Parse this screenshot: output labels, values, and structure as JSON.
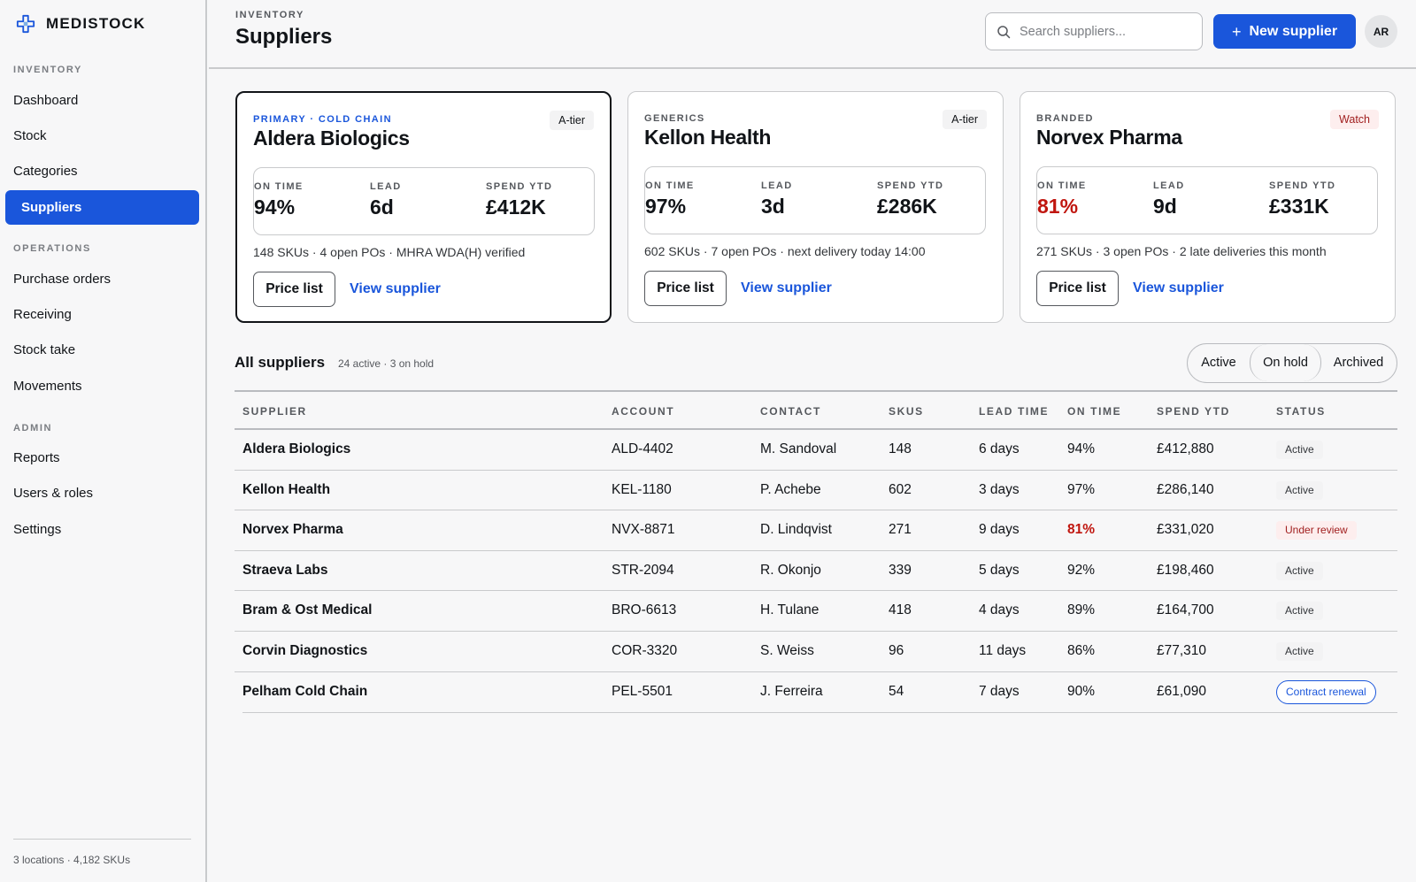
{
  "brand": {
    "name": "MEDISTOCK",
    "icon": "medical-cross-icon",
    "accent": "#1a56db"
  },
  "sidebar": {
    "sections": [
      {
        "label": "INVENTORY",
        "items": [
          "Dashboard",
          "Stock",
          "Categories",
          "Suppliers"
        ]
      },
      {
        "label": "OPERATIONS",
        "items": [
          "Purchase orders",
          "Receiving",
          "Stock take",
          "Movements"
        ]
      },
      {
        "label": "ADMIN",
        "items": [
          "Reports",
          "Users & roles",
          "Settings"
        ]
      }
    ],
    "active_item": "Suppliers",
    "footer": "3 locations · 4,182 SKUs"
  },
  "header": {
    "breadcrumb": "INVENTORY",
    "title": "Suppliers",
    "search_placeholder": "Search suppliers...",
    "new_button": "New supplier",
    "avatar": "AR"
  },
  "cards": [
    {
      "tag": "PRIMARY · COLD CHAIN",
      "name": "Aldera Biologics",
      "badge": "A-tier",
      "stats": [
        {
          "label": "ON TIME",
          "value": "94%"
        },
        {
          "label": "LEAD",
          "value": "6d"
        },
        {
          "label": "SPEND YTD",
          "value": "£412K"
        }
      ],
      "meta": "148 SKUs · 4 open POs · MHRA WDA(H) verified",
      "price_button": "Price list",
      "view_link": "View supplier"
    },
    {
      "tag": "GENERICS",
      "name": "Kellon Health",
      "badge": "A-tier",
      "stats": [
        {
          "label": "ON TIME",
          "value": "97%"
        },
        {
          "label": "LEAD",
          "value": "3d"
        },
        {
          "label": "SPEND YTD",
          "value": "£286K"
        }
      ],
      "meta": "602 SKUs · 7 open POs · next delivery today 14:00",
      "price_button": "Price list",
      "view_link": "View supplier"
    },
    {
      "tag": "BRANDED",
      "name": "Norvex Pharma",
      "badge": "Watch",
      "stats": [
        {
          "label": "ON TIME",
          "value": "81%"
        },
        {
          "label": "LEAD",
          "value": "9d"
        },
        {
          "label": "SPEND YTD",
          "value": "£331K"
        }
      ],
      "meta": "271 SKUs · 3 open POs · 2 late deliveries this month",
      "price_button": "Price list",
      "view_link": "View supplier"
    }
  ],
  "all_suppliers": {
    "title": "All suppliers",
    "subtitle": "24 active · 3 on hold",
    "filters": [
      "Active",
      "On hold",
      "Archived"
    ],
    "columns": [
      "SUPPLIER",
      "ACCOUNT",
      "CONTACT",
      "SKUS",
      "LEAD TIME",
      "ON TIME",
      "SPEND YTD",
      "STATUS"
    ],
    "rows": [
      {
        "supplier": "Aldera Biologics",
        "account": "ALD-4402",
        "contact": "M. Sandoval",
        "skus": "148",
        "lead": "6 days",
        "ontime": "94%",
        "spend": "£412,880",
        "status": "Active"
      },
      {
        "supplier": "Kellon Health",
        "account": "KEL-1180",
        "contact": "P. Achebe",
        "skus": "602",
        "lead": "3 days",
        "ontime": "97%",
        "spend": "£286,140",
        "status": "Active"
      },
      {
        "supplier": "Norvex Pharma",
        "account": "NVX-8871",
        "contact": "D. Lindqvist",
        "skus": "271",
        "lead": "9 days",
        "ontime": "81%",
        "spend": "£331,020",
        "status": "Under review"
      },
      {
        "supplier": "Straeva Labs",
        "account": "STR-2094",
        "contact": "R. Okonjo",
        "skus": "339",
        "lead": "5 days",
        "ontime": "92%",
        "spend": "£198,460",
        "status": "Active"
      },
      {
        "supplier": "Bram & Ost Medical",
        "account": "BRO-6613",
        "contact": "H. Tulane",
        "skus": "418",
        "lead": "4 days",
        "ontime": "89%",
        "spend": "£164,700",
        "status": "Active"
      },
      {
        "supplier": "Corvin Diagnostics",
        "account": "COR-3320",
        "contact": "S. Weiss",
        "skus": "96",
        "lead": "11 days",
        "ontime": "86%",
        "spend": "£77,310",
        "status": "Active"
      },
      {
        "supplier": "Pelham Cold Chain",
        "account": "PEL-5501",
        "contact": "J. Ferreira",
        "skus": "54",
        "lead": "7 days",
        "ontime": "90%",
        "spend": "£61,090",
        "status": "Contract renewal"
      }
    ]
  },
  "colors": {
    "accent": "#1a56db",
    "alert": "#c0160f",
    "border": "#c9cacc"
  }
}
